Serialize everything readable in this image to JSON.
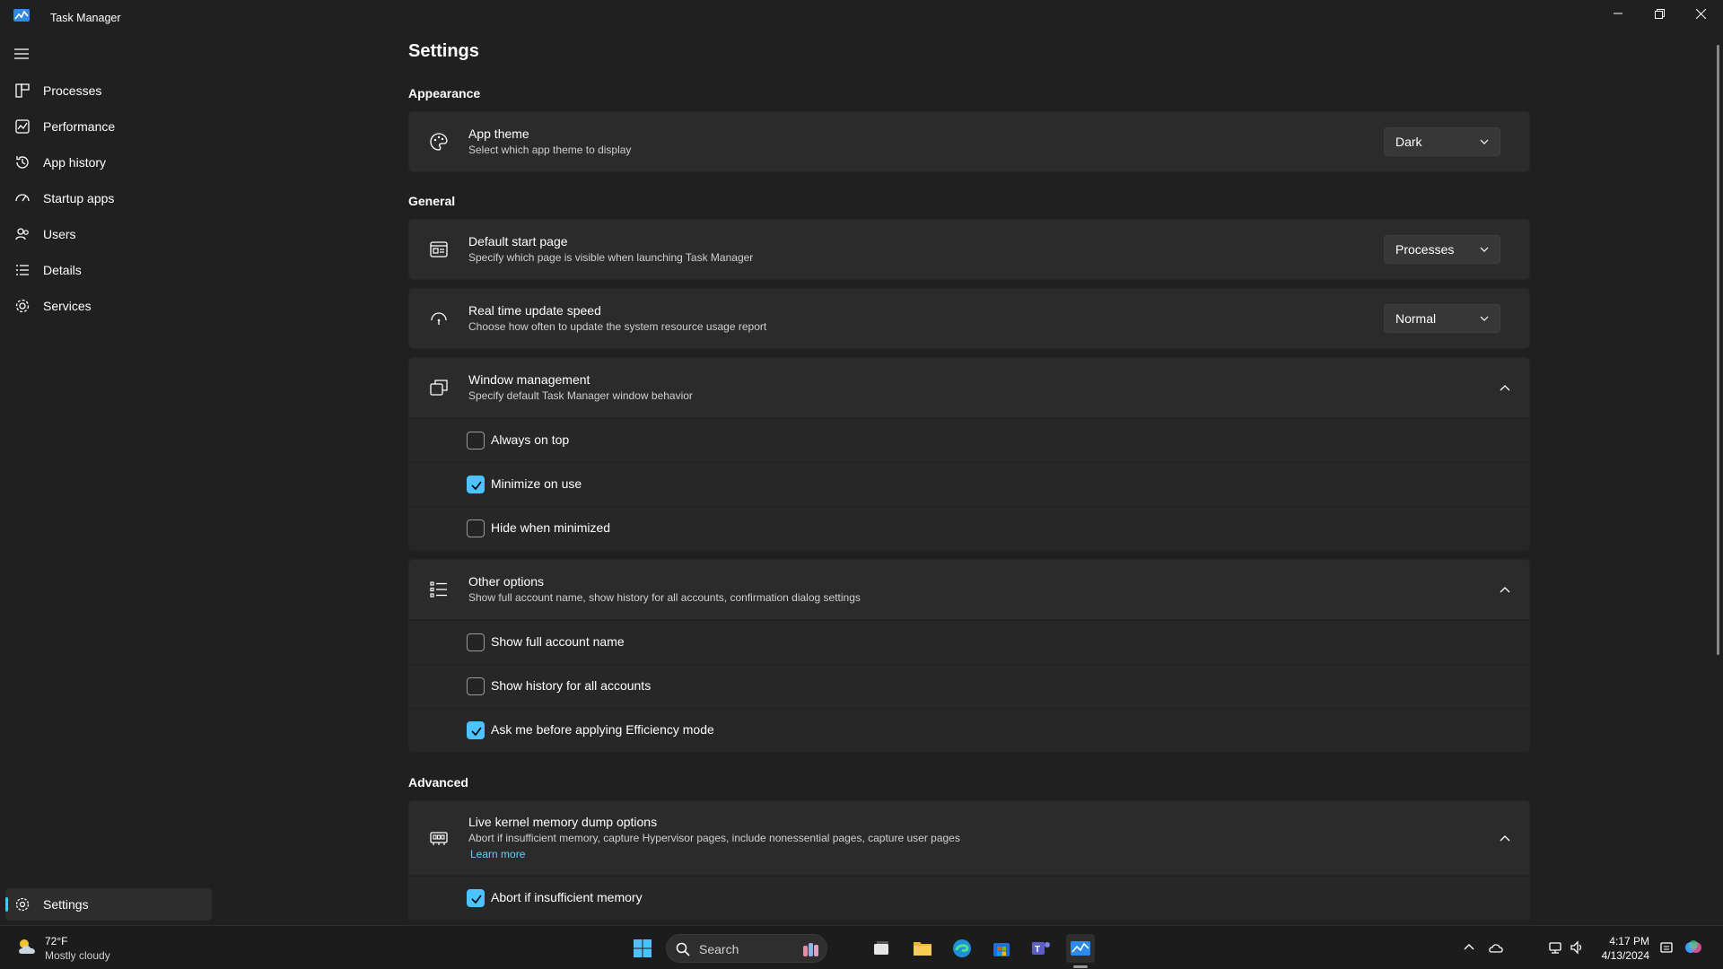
{
  "window": {
    "title": "Task Manager"
  },
  "sidebar": {
    "items": [
      {
        "label": "Processes",
        "icon": "processes-icon"
      },
      {
        "label": "Performance",
        "icon": "performance-icon"
      },
      {
        "label": "App history",
        "icon": "history-icon"
      },
      {
        "label": "Startup apps",
        "icon": "startup-icon"
      },
      {
        "label": "Users",
        "icon": "users-icon"
      },
      {
        "label": "Details",
        "icon": "details-icon"
      },
      {
        "label": "Services",
        "icon": "services-icon"
      }
    ],
    "settings_label": "Settings"
  },
  "main": {
    "title": "Settings",
    "appearance": {
      "heading": "Appearance",
      "app_theme": {
        "title": "App theme",
        "desc": "Select which app theme to display",
        "value": "Dark"
      }
    },
    "general": {
      "heading": "General",
      "start_page": {
        "title": "Default start page",
        "desc": "Specify which page is visible when launching Task Manager",
        "value": "Processes"
      },
      "update_speed": {
        "title": "Real time update speed",
        "desc": "Choose how often to update the system resource usage report",
        "value": "Normal"
      },
      "window_mgmt": {
        "title": "Window management",
        "desc": "Specify default Task Manager window behavior",
        "options": [
          {
            "label": "Always on top",
            "checked": false
          },
          {
            "label": "Minimize on use",
            "checked": true
          },
          {
            "label": "Hide when minimized",
            "checked": false
          }
        ]
      },
      "other_options": {
        "title": "Other options",
        "desc": "Show full account name, show history for all accounts, confirmation dialog settings",
        "options": [
          {
            "label": "Show full account name",
            "checked": false
          },
          {
            "label": "Show history for all accounts",
            "checked": false
          },
          {
            "label": "Ask me before applying Efficiency mode",
            "checked": true
          }
        ]
      }
    },
    "advanced": {
      "heading": "Advanced",
      "kernel_dump": {
        "title": "Live kernel memory dump options",
        "desc": "Abort if insufficient memory, capture Hypervisor pages, include nonessential pages, capture user pages",
        "link": "Learn more",
        "options": [
          {
            "label": "Abort if insufficient memory",
            "checked": true
          }
        ]
      }
    }
  },
  "taskbar": {
    "weather_temp": "72°F",
    "weather_desc": "Mostly cloudy",
    "search_placeholder": "Search",
    "time": "4:17 PM",
    "date": "4/13/2024"
  },
  "colors": {
    "accent": "#4cc2ff",
    "background": "#202020",
    "card": "#2b2b2b"
  }
}
